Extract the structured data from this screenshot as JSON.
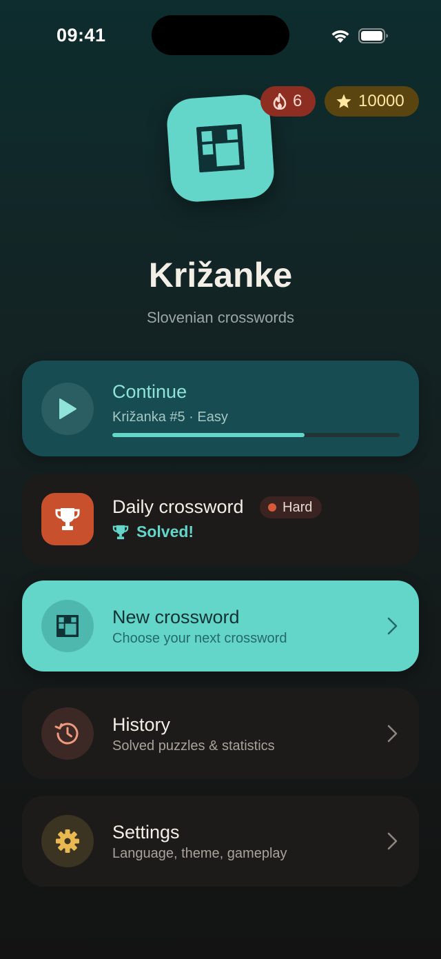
{
  "status_bar": {
    "time": "09:41",
    "icons": [
      "wifi-icon",
      "battery-icon"
    ]
  },
  "header": {
    "app_icon": "crossword-grid-icon",
    "streak": {
      "icon": "flame-icon",
      "value": "6"
    },
    "stars": {
      "icon": "star-icon",
      "value": "10000"
    },
    "title": "Križanke",
    "subtitle": "Slovenian crosswords"
  },
  "cards": {
    "continue": {
      "icon": "play-icon",
      "title": "Continue",
      "subtitle": "Križanka #5 · Easy",
      "progress": 0.67
    },
    "daily": {
      "icon": "trophy-icon",
      "title": "Daily crossword",
      "difficulty": "Hard",
      "status": "Solved!"
    },
    "new_crossword": {
      "icon": "crossword-grid-icon",
      "title": "New crossword",
      "subtitle": "Choose your next crossword"
    },
    "history": {
      "icon": "history-icon",
      "title": "History",
      "subtitle": "Solved puzzles & statistics"
    },
    "settings": {
      "icon": "gear-icon",
      "title": "Settings",
      "subtitle": "Language, theme, gameplay"
    }
  },
  "colors": {
    "accent": "#63d5c9",
    "continue_card": "#174c52",
    "daily_tile": "#c9502d",
    "streak_badge": "#8e2e22",
    "stars_badge": "#5a4410"
  }
}
